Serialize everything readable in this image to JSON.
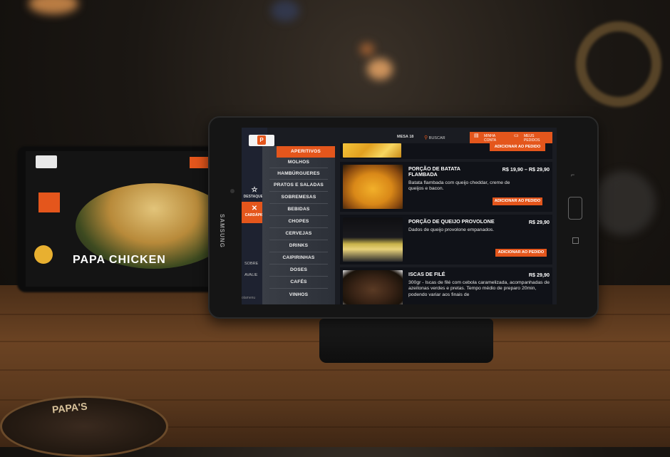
{
  "screen": {
    "header": {
      "logo_letter": "P",
      "table_label": "MESA 18",
      "search_label": "BUSCAR",
      "account_label": "MINHA CONTA",
      "orders_label": "MEUS PEDIDOS"
    },
    "sidebar": {
      "items": [
        {
          "icon": "star-icon",
          "glyph": "☆",
          "label": "DESTAQUES",
          "active": false
        },
        {
          "icon": "utensils-icon",
          "glyph": "✕",
          "label": "CARDÁPIO",
          "active": true
        }
      ],
      "links": [
        "SOBRE",
        "AVALIE"
      ],
      "footer": "olamenu"
    },
    "menu": {
      "categories": [
        {
          "label": "APERITIVOS",
          "active": true
        },
        {
          "label": "MOLHOS",
          "active": false
        },
        {
          "label": "HAMBÚRGUERES",
          "active": false
        },
        {
          "label": "PRATOS E SALADAS",
          "active": false
        },
        {
          "label": "SOBREMESAS",
          "active": false
        },
        {
          "label": "BEBIDAS",
          "active": false
        },
        {
          "label": "CHOPES",
          "active": false
        },
        {
          "label": "CERVEJAS",
          "active": false
        },
        {
          "label": "DRINKS",
          "active": false
        },
        {
          "label": "CAIPIRINHAS",
          "active": false
        },
        {
          "label": "DOSES",
          "active": false
        },
        {
          "label": "CAFÉS",
          "active": false
        },
        {
          "label": "VINHOS",
          "active": false
        }
      ]
    },
    "products": [
      {
        "title": "",
        "price": "",
        "description": "",
        "add_label": "ADICIONAR AO PEDIDO",
        "image": "fries-image"
      },
      {
        "title": "PORÇÃO DE BATATA FLAMBADA",
        "price": "R$ 19,90 – R$ 29,90",
        "description": "Batata flambada com queijo cheddar, creme de queijos e bacon.",
        "add_label": "ADICIONAR AO PEDIDO",
        "image": "cheese-fries-image"
      },
      {
        "title": "PORÇÃO DE QUEIJO PROVOLONE",
        "price": "R$ 29,90",
        "description": "Dados de queijo provolone empanados.",
        "add_label": "ADICIONAR AO PEDIDO",
        "image": "provolone-image"
      },
      {
        "title": "ISCAS DE FILÉ",
        "price": "R$ 29,90",
        "description": "300gr - Iscas de filé com cebola caramelizada, acompanhadas de azeitonas verdes e pretas. Tempo médio de preparo 20min, podendo variar aos finais de",
        "add_label": "",
        "image": "steak-strips-image"
      }
    ]
  },
  "background_tablet": {
    "title": "PAPA CHICKEN"
  },
  "device": {
    "brand": "SAMSUNG"
  },
  "coaster": {
    "text": "PAPA'S"
  },
  "colors": {
    "accent": "#e4561c",
    "screen_bg": "#1a1c22",
    "menu_bg": "#3a3e46"
  }
}
